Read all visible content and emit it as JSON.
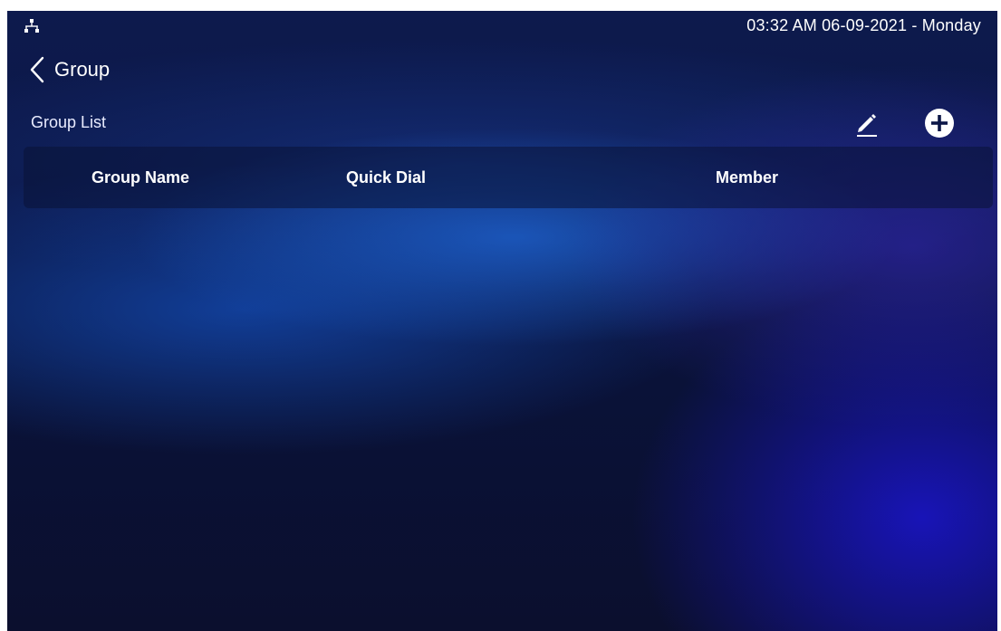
{
  "status_bar": {
    "network_icon": "network-tree-icon",
    "datetime": "03:32 AM  06-09-2021 - Monday"
  },
  "header": {
    "back_icon": "chevron-left-icon",
    "title": "Group"
  },
  "group_list": {
    "label": "Group List",
    "edit_icon": "pencil-icon",
    "add_icon": "plus-circle-icon",
    "columns": [
      "Group Name",
      "Quick Dial",
      "Member"
    ],
    "rows": []
  },
  "colors": {
    "background_dark": "#0b1035",
    "accent_blue": "#1e64d2",
    "accent_violet": "#1914be",
    "text": "#ffffff"
  }
}
